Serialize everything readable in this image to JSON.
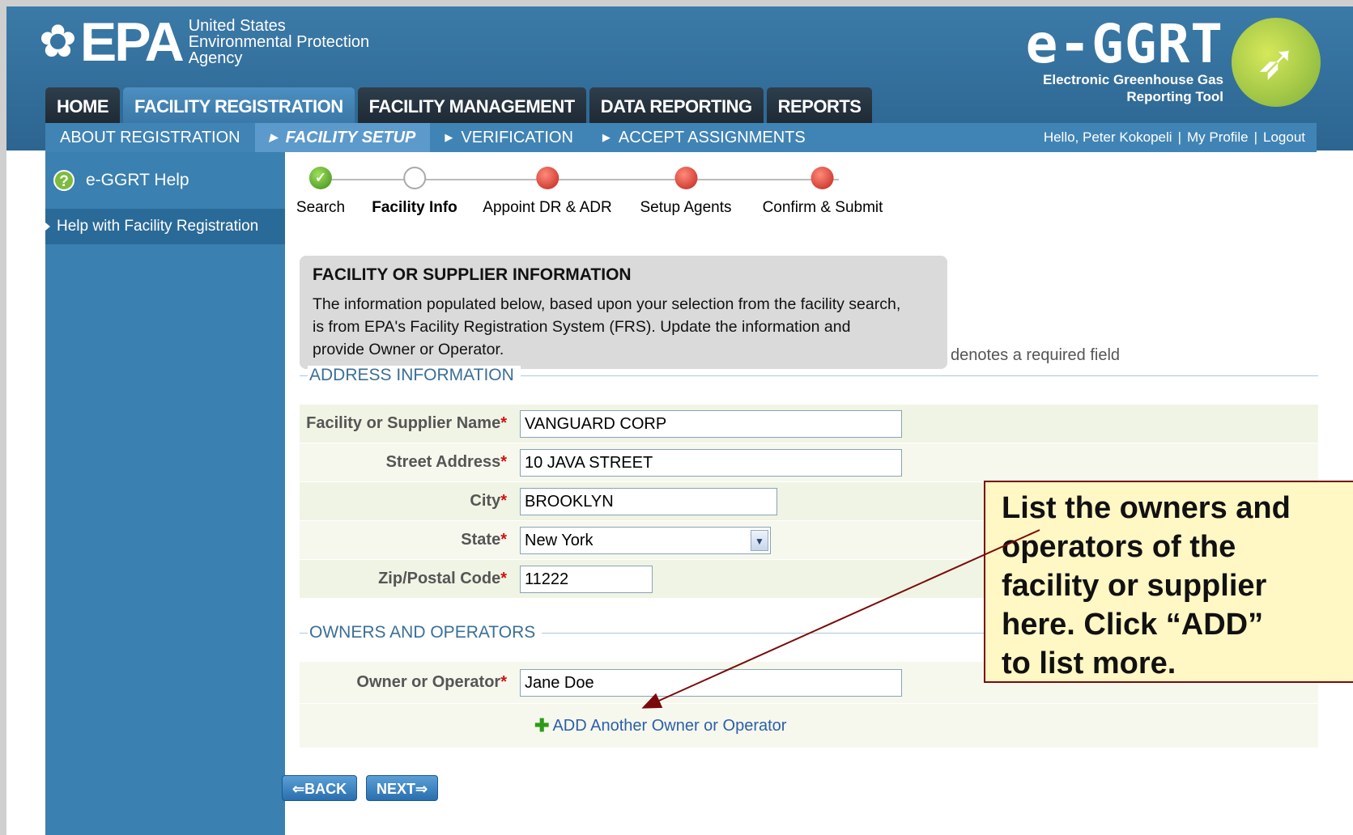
{
  "header": {
    "agency_line1": "United States",
    "agency_line2": "Environmental Protection",
    "agency_line3": "Agency",
    "logo_word": "EPA",
    "app_title": "e-GGRT",
    "app_subtitle1": "Electronic Greenhouse Gas",
    "app_subtitle2": "Reporting Tool"
  },
  "tabs": [
    {
      "label": "HOME"
    },
    {
      "label": "FACILITY REGISTRATION"
    },
    {
      "label": "FACILITY MANAGEMENT"
    },
    {
      "label": "DATA REPORTING"
    },
    {
      "label": "REPORTS"
    }
  ],
  "subnav": [
    {
      "label": "ABOUT REGISTRATION"
    },
    {
      "label": "FACILITY SETUP"
    },
    {
      "label": "VERIFICATION"
    },
    {
      "label": "ACCEPT ASSIGNMENTS"
    }
  ],
  "user": {
    "greeting": "Hello, Peter Kokopeli",
    "profile": "My Profile",
    "logout": "Logout"
  },
  "sidebar": {
    "help_label": "e-GGRT Help",
    "link": "Help with Facility Registration"
  },
  "steps": [
    {
      "label": "Search",
      "state": "done"
    },
    {
      "label": "Facility Info",
      "state": "current"
    },
    {
      "label": "Appoint DR & ADR",
      "state": "todo"
    },
    {
      "label": "Setup Agents",
      "state": "todo"
    },
    {
      "label": "Confirm & Submit",
      "state": "todo"
    }
  ],
  "info": {
    "title": "FACILITY OR SUPPLIER INFORMATION",
    "line1": "The information populated below, based upon your selection from the facility search,",
    "line2": "is from EPA's Facility Registration System (FRS). Update the information and",
    "line3": "provide Owner or Operator."
  },
  "required_note": "denotes a required field",
  "address": {
    "section_title": "ADDRESS INFORMATION",
    "name_label": "Facility or Supplier Name",
    "name_value": "VANGUARD CORP",
    "street_label": "Street Address",
    "street_value": "10 JAVA STREET",
    "city_label": "City",
    "city_value": "BROOKLYN",
    "state_label": "State",
    "state_value": "New York",
    "zip_label": "Zip/Postal Code",
    "zip_value": "11222"
  },
  "owners": {
    "section_title": "OWNERS AND OPERATORS",
    "owner_label": "Owner or Operator",
    "owner_value": "Jane Doe",
    "add_link": "ADD Another Owner or Operator"
  },
  "buttons": {
    "back": "BACK",
    "next": "NEXT"
  },
  "callout": {
    "line1": "List the owners and",
    "line2": "operators of the",
    "line3": "facility or supplier",
    "line4": "here.  Click “ADD”",
    "line5": "to list more."
  },
  "colors": {
    "header_blue": "#2c6590",
    "tab_dark": "#1e2a35",
    "required_star": "#d21010",
    "callout_border": "#7a0a0a"
  }
}
